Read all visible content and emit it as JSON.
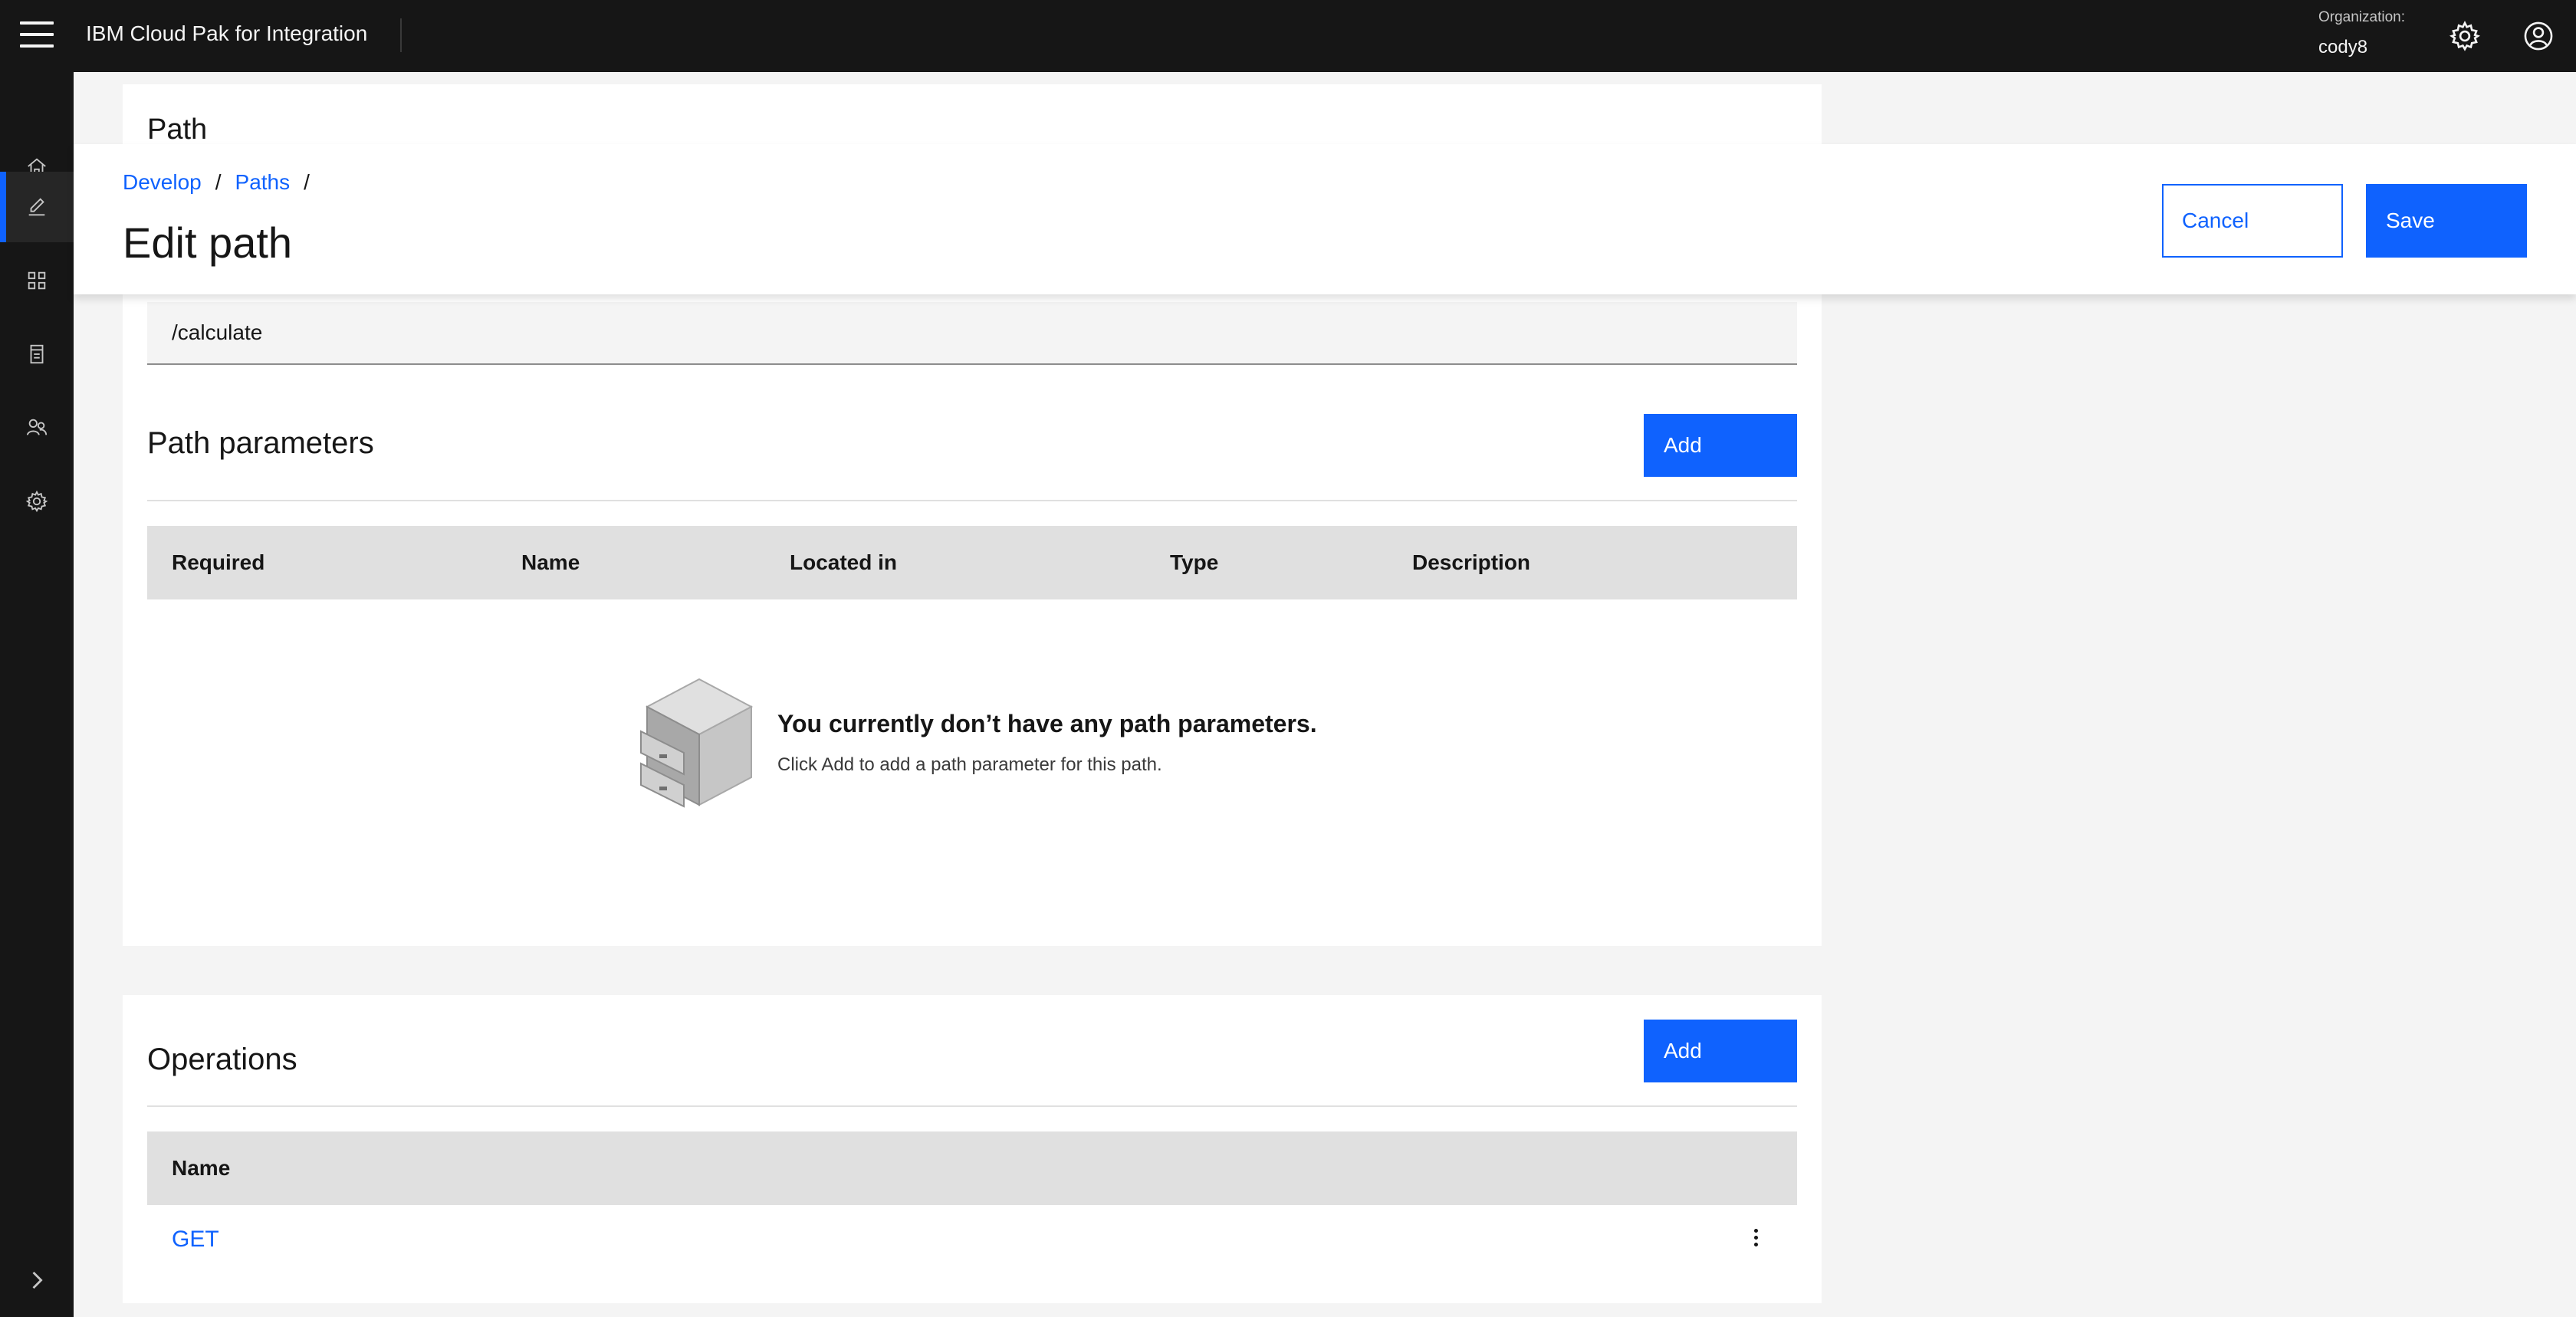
{
  "header": {
    "product_name": "IBM Cloud Pak for Integration",
    "org_label": "Organization:",
    "org_value": "cody8"
  },
  "sidenav": {
    "items": [
      {
        "icon": "home-icon"
      },
      {
        "icon": "edit-icon",
        "active": true
      },
      {
        "icon": "apps-grid-icon"
      },
      {
        "icon": "catalog-icon"
      },
      {
        "icon": "users-icon"
      },
      {
        "icon": "settings-icon"
      }
    ],
    "expand_icon": "chevron-right-icon"
  },
  "edit_header": {
    "breadcrumb": [
      {
        "label": "Develop"
      },
      {
        "label": "Paths"
      }
    ],
    "breadcrumb_sep": "/",
    "title": "Edit path",
    "cancel_label": "Cancel",
    "save_label": "Save"
  },
  "path_card": {
    "title": "Path",
    "path_value": "/calculate",
    "params_title": "Path parameters",
    "add_label": "Add",
    "columns": [
      "Required",
      "Name",
      "Located in",
      "Type",
      "Description"
    ],
    "empty_title": "You currently don’t have any path parameters.",
    "empty_subtitle": "Click Add to add a path parameter for this path."
  },
  "operations_card": {
    "title": "Operations",
    "add_label": "Add",
    "columns": [
      "Name"
    ],
    "rows": [
      {
        "name": "GET"
      }
    ]
  },
  "colors": {
    "accent": "#0f62fe",
    "header_bg": "#161616",
    "page_bg": "#f4f4f4"
  }
}
